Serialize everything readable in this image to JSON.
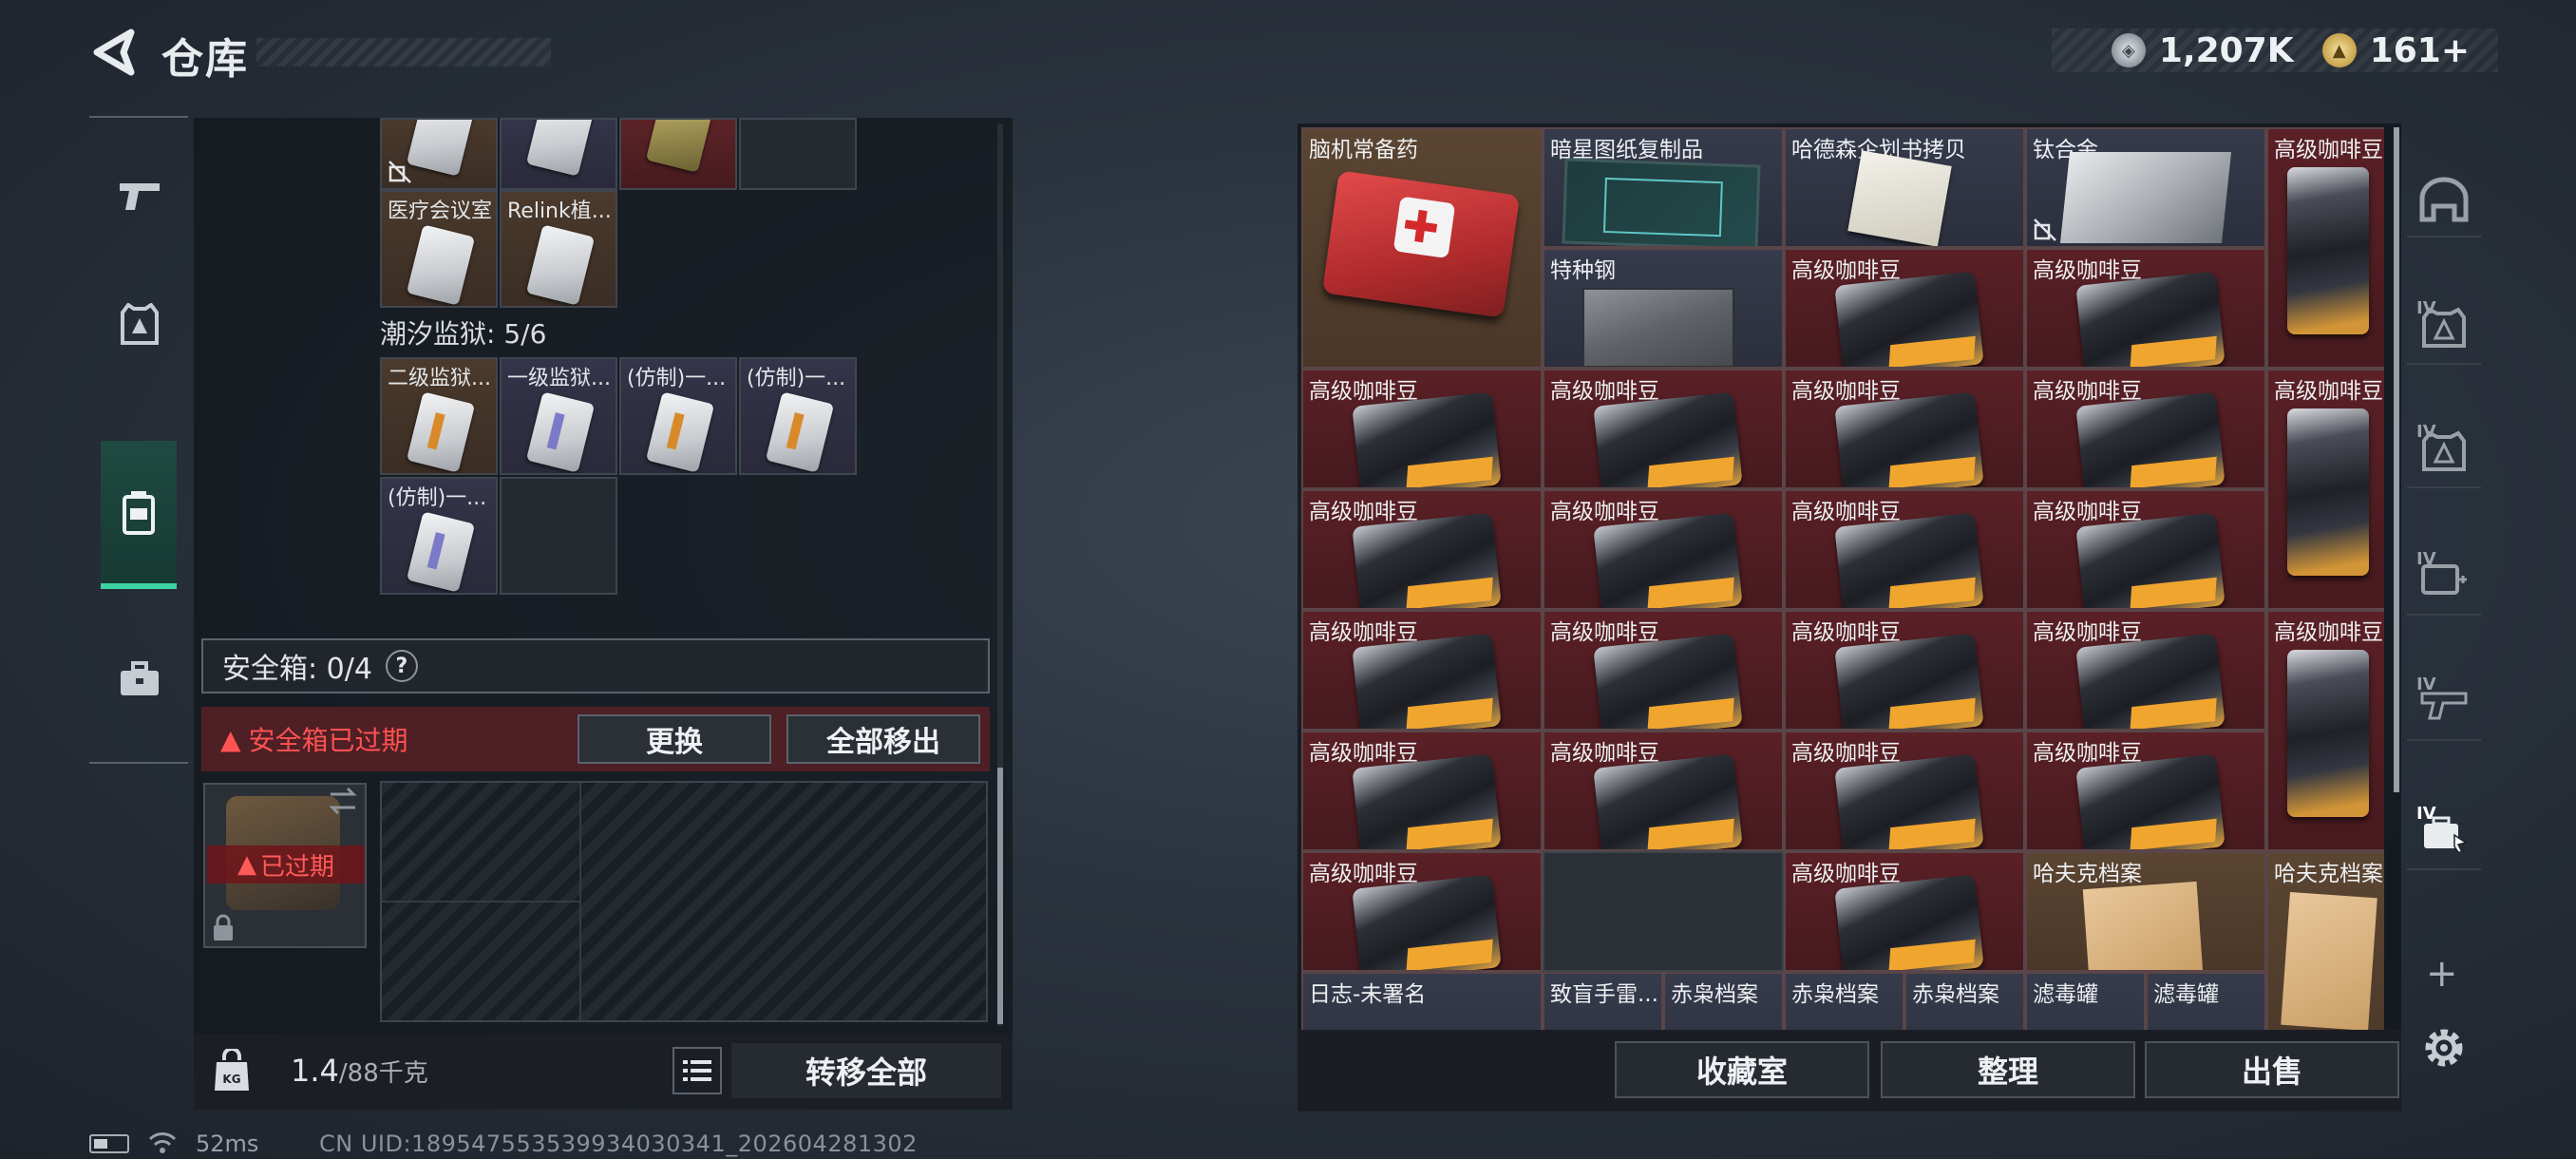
{
  "header": {
    "title": "仓库",
    "currency": [
      {
        "icon": "silver-coin-icon",
        "value": "1,207K"
      },
      {
        "icon": "gold-coin-icon",
        "value": "161+"
      }
    ]
  },
  "left_nav": {
    "items": [
      {
        "icon": "gun-icon"
      },
      {
        "icon": "armor-icon"
      },
      {
        "icon": "backpack-icon",
        "active": true
      },
      {
        "icon": "toolbox-icon"
      }
    ]
  },
  "left_panel": {
    "top_items": [
      {
        "label": "医疗会议室",
        "rarity": "orange"
      },
      {
        "label": "Relink植...",
        "rarity": "orange"
      }
    ],
    "prison_section": "潮汐监狱: 5/6",
    "prison_items": [
      {
        "label": "二级监狱...",
        "rarity": "orange"
      },
      {
        "label": "一级监狱...",
        "rarity": "purple"
      },
      {
        "label": "(仿制)一...",
        "rarity": "purple"
      },
      {
        "label": "(仿制)一...",
        "rarity": "purple"
      },
      {
        "label": "(仿制)一...",
        "rarity": "purple"
      }
    ],
    "safe_box": {
      "label": "安全箱: 0/4",
      "help": "?",
      "expired_warning": "安全箱已过期",
      "replace_button": "更换",
      "remove_all_button": "全部移出",
      "slot_expired": "已过期"
    },
    "weight": {
      "current": "1.4",
      "max": "/88千克"
    },
    "transfer_all_button": "转移全部"
  },
  "right_grid": {
    "labels": {
      "medkit": "脑机常备药",
      "blueprint": "暗星图纸复制品",
      "hadesen_copy": "哈德森企划书拷贝",
      "titanium": "钛合金",
      "coffee": "高级咖啡豆",
      "steel": "特种钢",
      "havoc_archive": "哈夫克档案",
      "diary": "日志-未署名",
      "tribute": "致盲手雷...",
      "owl_archive": "赤枭档案",
      "filter": "滤毒罐"
    }
  },
  "right_bottom": {
    "collection_button": "收藏室",
    "sort_button": "整理",
    "sell_button": "出售"
  },
  "right_nav": {
    "tag": "IV",
    "items": [
      {
        "icon": "helmet-icon"
      },
      {
        "icon": "armor-iv-icon"
      },
      {
        "icon": "armor-iv-icon-2"
      },
      {
        "icon": "medkit-iv-icon"
      },
      {
        "icon": "gun-iv-icon"
      },
      {
        "icon": "case-iv-icon",
        "active": true
      }
    ]
  },
  "status": {
    "ping": "52ms",
    "uid": "CN UID:18954755353993403034‍1_202604281302"
  }
}
